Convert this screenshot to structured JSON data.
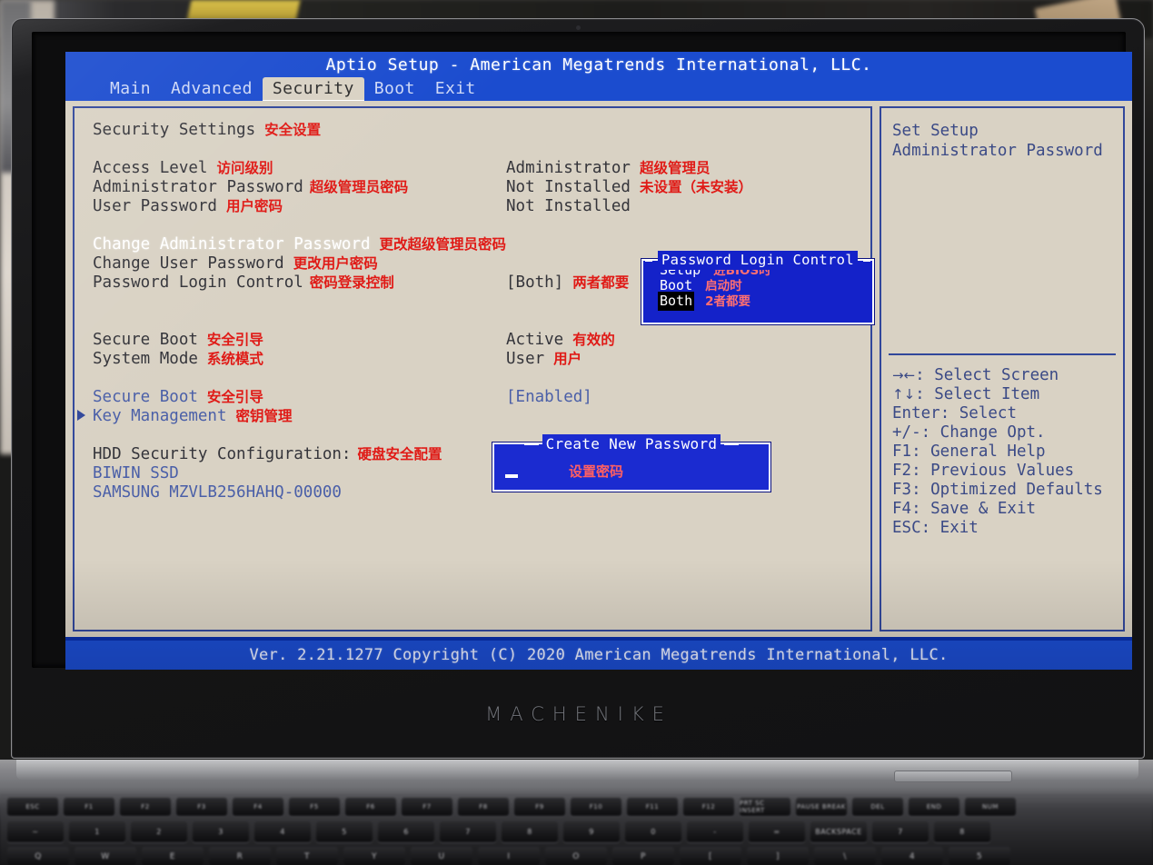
{
  "device": {
    "brand": "MACHENIKE"
  },
  "bios": {
    "title": "Aptio Setup - American Megatrends International, LLC.",
    "tabs": [
      {
        "label": "Main",
        "active": false
      },
      {
        "label": "Advanced",
        "active": false
      },
      {
        "label": "Security",
        "active": true
      },
      {
        "label": "Boot",
        "active": false
      },
      {
        "label": "Exit",
        "active": false
      }
    ],
    "footer": "Ver. 2.21.1277 Copyright (C) 2020 American Megatrends International, LLC.",
    "section_heading": {
      "en": "Security Settings",
      "cn": "安全设置"
    },
    "rows": [
      {
        "en": "Access Level",
        "cn": "访问级别",
        "value_en": "Administrator",
        "value_cn": "超级管理员"
      },
      {
        "en": "Administrator Password",
        "cn": "超级管理员密码",
        "value_en": "Not Installed",
        "value_cn": "未设置（未安装）"
      },
      {
        "en": "User Password",
        "cn": "用户密码",
        "value_en": "Not Installed",
        "value_cn": ""
      },
      {
        "en": "Change Administrator Password",
        "cn": "更改超级管理员密码",
        "value_en": "",
        "value_cn": ""
      },
      {
        "en": "Change User Password",
        "cn": "更改用户密码",
        "value_en": "",
        "value_cn": ""
      },
      {
        "en": "Password Login Control",
        "cn": "密码登录控制",
        "value_en": "[Both]",
        "value_cn": "两者都要"
      },
      {
        "en": "Secure Boot",
        "cn": "安全引导",
        "value_en": "Active",
        "value_cn": "有效的"
      },
      {
        "en": "System Mode",
        "cn": "系统模式",
        "value_en": "User",
        "value_cn": "用户"
      },
      {
        "en": "Secure Boot",
        "cn": "安全引导",
        "value_en": "[Enabled]",
        "value_cn": ""
      },
      {
        "en": "Key Management",
        "cn": "密钥管理",
        "value_en": "",
        "value_cn": ""
      },
      {
        "en": "HDD Security Configuration:",
        "cn": "硬盘安全配置",
        "value_en": "",
        "value_cn": ""
      },
      {
        "en": "BIWIN SSD",
        "cn": "",
        "value_en": "",
        "value_cn": ""
      },
      {
        "en": "SAMSUNG MZVLB256HAHQ-00000",
        "cn": "",
        "value_en": "",
        "value_cn": ""
      }
    ],
    "help": {
      "text_line1": "Set Setup",
      "text_line2": "Administrator Password",
      "keys": [
        {
          "key": "→←",
          "desc": ": Select Screen"
        },
        {
          "key": "↑↓",
          "desc": ": Select Item"
        },
        {
          "key": "Enter",
          "desc": ": Select"
        },
        {
          "key": "+/-",
          "desc": ": Change Opt."
        },
        {
          "key": "F1",
          "desc": ": General Help"
        },
        {
          "key": "F2",
          "desc": ": Previous Values"
        },
        {
          "key": "F3",
          "desc": ": Optimized Defaults"
        },
        {
          "key": "F4",
          "desc": ": Save & Exit"
        },
        {
          "key": "ESC",
          "desc": ": Exit"
        }
      ]
    },
    "popup_password_login_control": {
      "title": "Password Login Control",
      "options": [
        {
          "label": "Setup",
          "cn": "进BIOS时",
          "selected": false
        },
        {
          "label": "Boot",
          "cn": "启动时",
          "selected": false
        },
        {
          "label": "Both",
          "cn": "2者都要",
          "selected": true
        }
      ]
    },
    "popup_create_new_password": {
      "title": "Create New Password",
      "cn": "设置密码",
      "input_value": ""
    },
    "colors": {
      "bios_blue": "#1b4ccf",
      "panel_bg": "#d9d2c4",
      "panel_border": "#31479b",
      "annotation_red": "#e01a16",
      "popup_blue": "#1422c9",
      "submenu_blue": "#4a5fa8"
    }
  },
  "keyboard": {
    "row1": [
      "ESC",
      "F1",
      "F2",
      "F3",
      "F4",
      "F5",
      "F6",
      "F7",
      "F8",
      "F9",
      "F10",
      "F11",
      "F12",
      "PRT SC INSERT",
      "PAUSE BREAK",
      "DEL",
      "END",
      "NUM"
    ],
    "row2": [
      "~",
      "1",
      "2",
      "3",
      "4",
      "5",
      "6",
      "7",
      "8",
      "9",
      "0",
      "-",
      "=",
      "BACKSPACE",
      "7",
      "8"
    ],
    "row3": [
      "Q",
      "W",
      "E",
      "R",
      "T",
      "Y",
      "U",
      "I",
      "O",
      "P",
      "[",
      "]",
      "\\",
      "4",
      "5"
    ]
  }
}
